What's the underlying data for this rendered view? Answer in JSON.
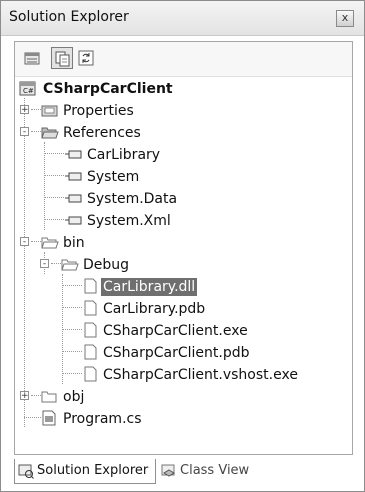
{
  "window": {
    "title": "Solution Explorer",
    "close_glyph": "x"
  },
  "tree": {
    "solution": "CSharpCarClient",
    "properties": "Properties",
    "references": "References",
    "ref_items": [
      "CarLibrary",
      "System",
      "System.Data",
      "System.Xml"
    ],
    "bin": "bin",
    "debug": "Debug",
    "debug_items": [
      "CarLibrary.dll",
      "CarLibrary.pdb",
      "CSharpCarClient.exe",
      "CSharpCarClient.pdb",
      "CSharpCarClient.vshost.exe"
    ],
    "obj": "obj",
    "program": "Program.cs",
    "expanders": {
      "plus": "+",
      "minus": "-"
    }
  },
  "tabs": [
    {
      "label": "Solution Explorer",
      "icon": "solution-explorer-icon"
    },
    {
      "label": "Class View",
      "icon": "class-view-icon"
    }
  ],
  "toolbar": {
    "icons": [
      "properties-icon",
      "show-all-files-icon",
      "refresh-icon"
    ]
  }
}
